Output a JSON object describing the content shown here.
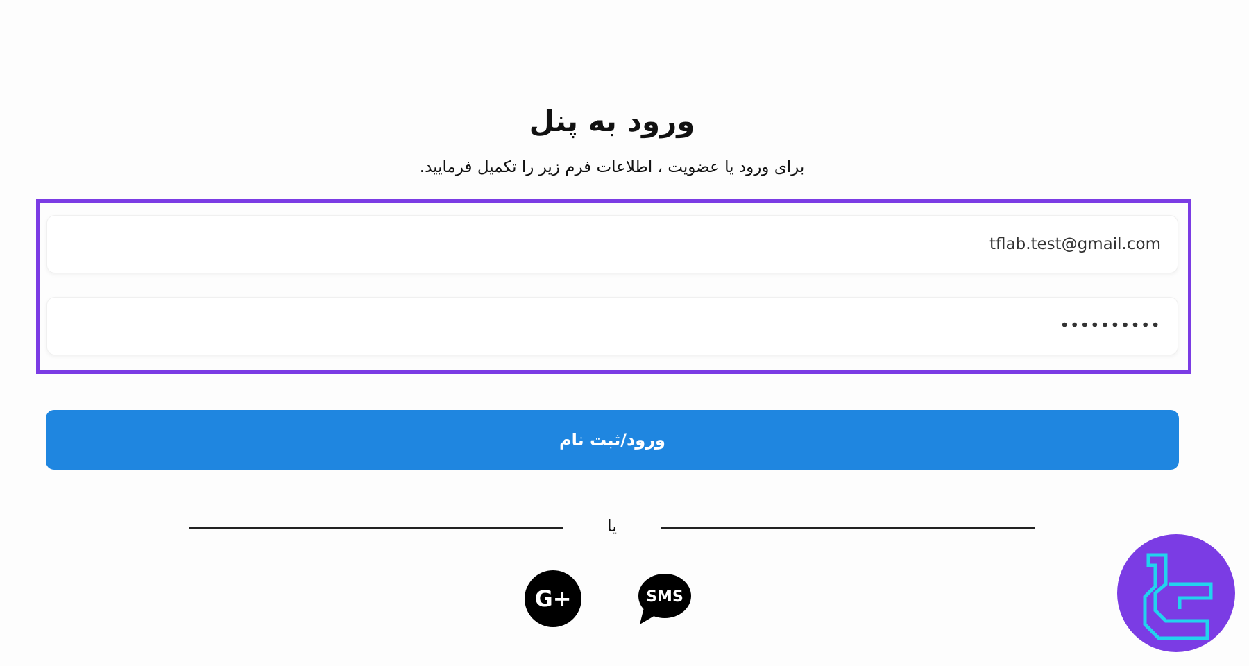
{
  "header": {
    "title": "ورود به پنل",
    "subtitle": "برای ورود یا عضویت ، اطلاعات فرم زیر را تکمیل فرمایید."
  },
  "form": {
    "email_value": "tflab.test@gmail.com",
    "password_value": "••••••••••"
  },
  "submit": {
    "label": "ورود/ثبت نام"
  },
  "divider": {
    "text": "یا"
  },
  "social": {
    "google_label": "G+",
    "sms_label": "SMS"
  },
  "colors": {
    "highlight": "#7b3ce4",
    "primary_button": "#1f86e0",
    "logo_bg": "#7b3ce4",
    "logo_fg": "#22d3ee"
  },
  "icons": {
    "google": "google-plus-icon",
    "sms": "sms-chat-icon",
    "brand": "brand-logo-icon"
  }
}
